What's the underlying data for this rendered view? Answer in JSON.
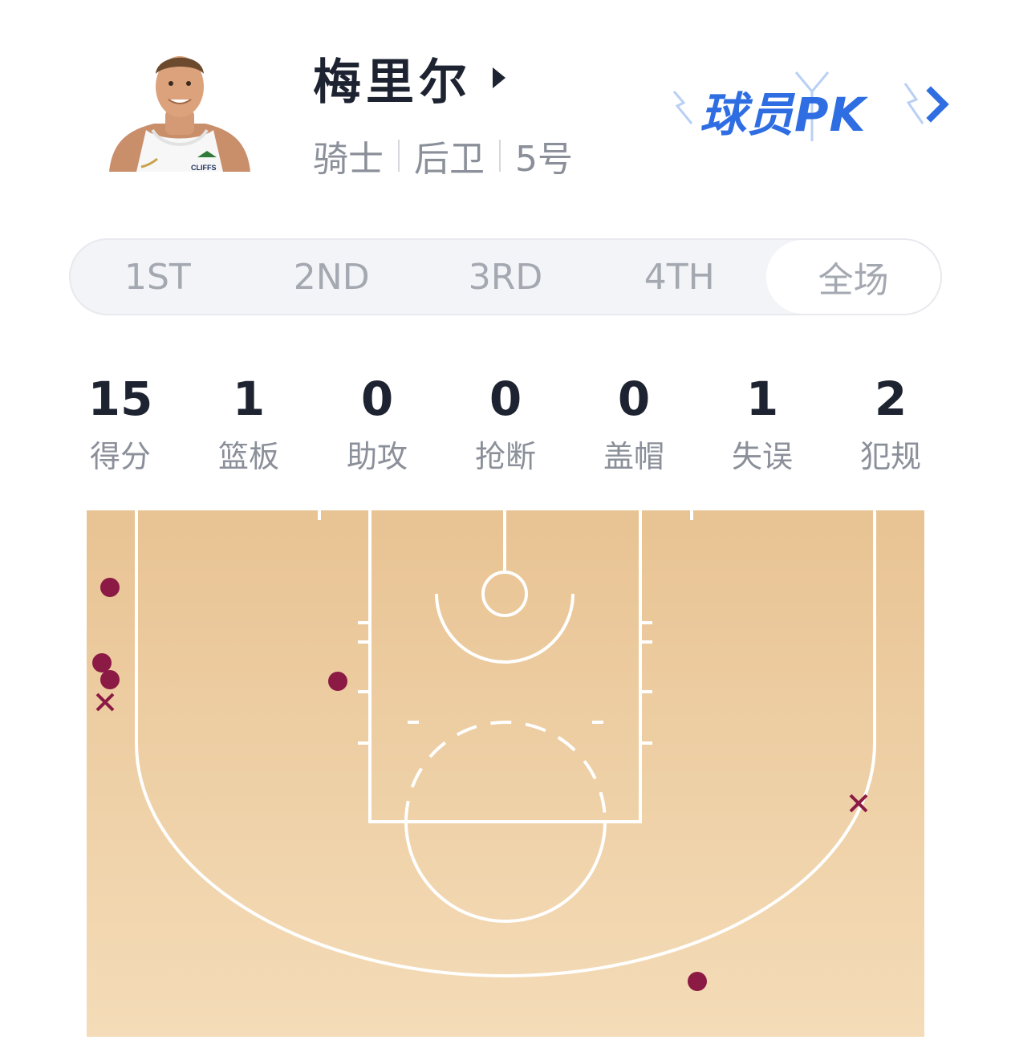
{
  "player": {
    "name": "梅里尔",
    "team": "骑士",
    "position": "后卫",
    "number": "5号",
    "avatar_icon": "player-photo"
  },
  "pk_button": {
    "label": "球员PK",
    "color": "#2f6de3"
  },
  "tabs": [
    {
      "label": "1ST",
      "active": false
    },
    {
      "label": "2ND",
      "active": false
    },
    {
      "label": "3RD",
      "active": false
    },
    {
      "label": "4TH",
      "active": false
    },
    {
      "label": "全场",
      "active": true
    }
  ],
  "stats": [
    {
      "value": "15",
      "label": "得分"
    },
    {
      "value": "1",
      "label": "篮板"
    },
    {
      "value": "0",
      "label": "助攻"
    },
    {
      "value": "0",
      "label": "抢断"
    },
    {
      "value": "0",
      "label": "盖帽"
    },
    {
      "value": "1",
      "label": "失误"
    },
    {
      "value": "2",
      "label": "犯规"
    }
  ],
  "shot_chart": {
    "colors": {
      "made": "#8b1a45",
      "missed": "#8b1a45",
      "floor": "#ebc99a",
      "lines": "#ffffff"
    },
    "shots": [
      {
        "result": "made"
      },
      {
        "result": "made"
      },
      {
        "result": "made"
      },
      {
        "result": "missed"
      },
      {
        "result": "made"
      },
      {
        "result": "missed"
      },
      {
        "result": "made"
      }
    ]
  }
}
